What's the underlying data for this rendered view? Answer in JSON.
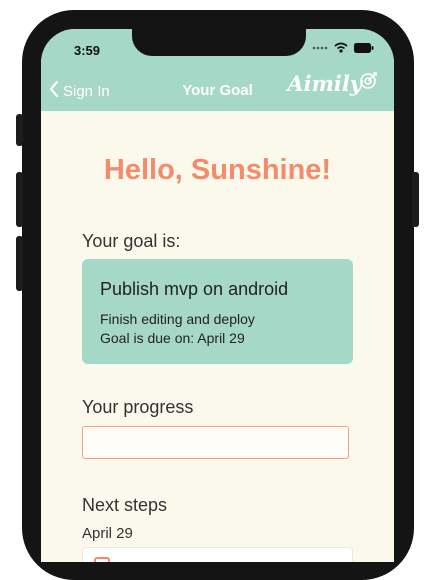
{
  "status_bar": {
    "time": "3:59",
    "icons": [
      "signal-dots-icon",
      "wifi-icon",
      "battery-icon"
    ]
  },
  "nav": {
    "back_label": "Sign In",
    "title": "Your Goal",
    "logo_text": "Aimily"
  },
  "greeting": "Hello, Sunshine!",
  "goal_section": {
    "label": "Your goal is:",
    "title": "Publish mvp on android",
    "description": "Finish editing and deploy",
    "due": "Goal is due on: April 29"
  },
  "progress": {
    "label": "Your progress",
    "value": "",
    "placeholder": ""
  },
  "next_steps": {
    "label": "Next steps",
    "date": "April 29"
  },
  "colors": {
    "mint": "#a5d8c6",
    "coral": "#f58b6a",
    "background": "#fbf8ec"
  }
}
